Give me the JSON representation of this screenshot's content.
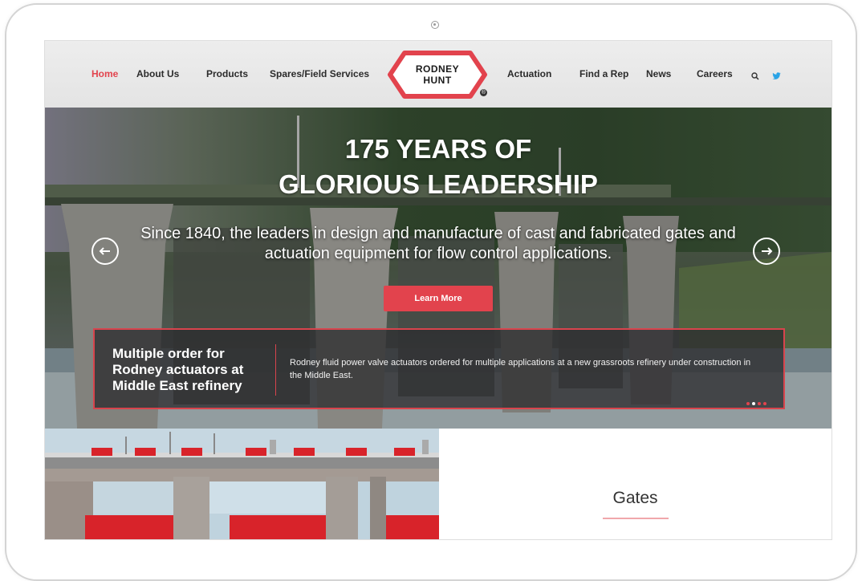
{
  "nav": {
    "items": [
      {
        "label": "Home",
        "active": true
      },
      {
        "label": "About Us"
      },
      {
        "label": "Products"
      },
      {
        "label": "Spares/Field Services"
      },
      {
        "label": "Actuation"
      },
      {
        "label": "Find a Rep"
      },
      {
        "label": "News"
      },
      {
        "label": "Careers"
      }
    ],
    "logo": {
      "line1": "RODNEY",
      "line2": "HUNT",
      "reg": "®"
    },
    "icons": [
      "search-icon",
      "twitter-icon"
    ]
  },
  "hero": {
    "title_line1": "175 YEARS OF",
    "title_line2": "GLORIOUS LEADERSHIP",
    "subtitle": "Since 1840, the leaders in design and manufacture of cast and fabricated gates and actuation equipment for flow control applications.",
    "button": "Learn More",
    "prev_icon": "arrow-left-icon",
    "next_icon": "arrow-right-icon"
  },
  "news": {
    "title": "Multiple order for Rodney actuators at Middle East refinery",
    "text": "Rodney fluid power valve actuators ordered for multiple applications at a new grassroots refinery under construction in the Middle East.",
    "slide_count": 4,
    "active_slide": 2
  },
  "section": {
    "title": "Gates"
  },
  "colors": {
    "accent": "#e2434d",
    "frame": "#d4d4d4"
  }
}
